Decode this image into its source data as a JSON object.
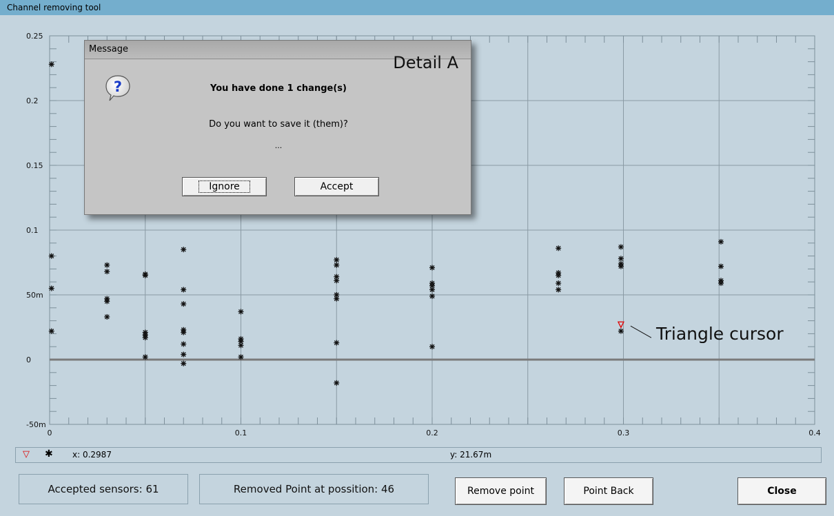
{
  "window": {
    "title": "Channel removing tool"
  },
  "chart_data": {
    "type": "scatter",
    "xlim": [
      0,
      0.4
    ],
    "ylim": [
      -0.05,
      0.25
    ],
    "x_ticks": [
      {
        "v": 0,
        "label": "0"
      },
      {
        "v": 0.1,
        "label": "0.1"
      },
      {
        "v": 0.2,
        "label": "0.2"
      },
      {
        "v": 0.3,
        "label": "0.3"
      },
      {
        "v": 0.4,
        "label": "0.4"
      }
    ],
    "y_ticks": [
      {
        "v": -0.05,
        "label": "-50m"
      },
      {
        "v": 0,
        "label": "0"
      },
      {
        "v": 0.05,
        "label": "50m"
      },
      {
        "v": 0.1,
        "label": "0.1"
      },
      {
        "v": 0.15,
        "label": "0.15"
      },
      {
        "v": 0.2,
        "label": "0.2"
      },
      {
        "v": 0.25,
        "label": "0.25"
      }
    ],
    "grid": true,
    "zero_line": true,
    "series": [
      {
        "marker": "asterisk",
        "points": [
          [
            0.001,
            0.228
          ],
          [
            0.001,
            0.08
          ],
          [
            0.001,
            0.055
          ],
          [
            0.001,
            0.022
          ],
          [
            0.03,
            0.073
          ],
          [
            0.03,
            0.068
          ],
          [
            0.03,
            0.047
          ],
          [
            0.03,
            0.045
          ],
          [
            0.03,
            0.033
          ],
          [
            0.05,
            0.066
          ],
          [
            0.05,
            0.065
          ],
          [
            0.05,
            0.021
          ],
          [
            0.05,
            0.019
          ],
          [
            0.05,
            0.017
          ],
          [
            0.05,
            0.002
          ],
          [
            0.07,
            0.085
          ],
          [
            0.07,
            0.054
          ],
          [
            0.07,
            0.043
          ],
          [
            0.07,
            0.023
          ],
          [
            0.07,
            0.021
          ],
          [
            0.07,
            0.012
          ],
          [
            0.07,
            0.004
          ],
          [
            0.07,
            -0.003
          ],
          [
            0.1,
            0.037
          ],
          [
            0.1,
            0.016
          ],
          [
            0.1,
            0.014
          ],
          [
            0.1,
            0.011
          ],
          [
            0.1,
            0.002
          ],
          [
            0.15,
            0.077
          ],
          [
            0.15,
            0.073
          ],
          [
            0.15,
            0.064
          ],
          [
            0.15,
            0.061
          ],
          [
            0.15,
            0.05
          ],
          [
            0.15,
            0.047
          ],
          [
            0.15,
            0.013
          ],
          [
            0.15,
            -0.018
          ],
          [
            0.2,
            0.071
          ],
          [
            0.2,
            0.059
          ],
          [
            0.2,
            0.057
          ],
          [
            0.2,
            0.054
          ],
          [
            0.2,
            0.049
          ],
          [
            0.2,
            0.01
          ],
          [
            0.266,
            0.086
          ],
          [
            0.266,
            0.067
          ],
          [
            0.266,
            0.065
          ],
          [
            0.266,
            0.059
          ],
          [
            0.266,
            0.054
          ],
          [
            0.2987,
            0.087
          ],
          [
            0.2987,
            0.078
          ],
          [
            0.2987,
            0.074
          ],
          [
            0.2987,
            0.072
          ],
          [
            0.2987,
            0.022
          ],
          [
            0.351,
            0.091
          ],
          [
            0.351,
            0.072
          ],
          [
            0.351,
            0.061
          ],
          [
            0.351,
            0.059
          ]
        ]
      },
      {
        "marker": "triangle-cursor",
        "color": "#e00000",
        "points": [
          [
            0.2987,
            0.027
          ]
        ]
      }
    ]
  },
  "annotation": {
    "triangle_label": "Triangle cursor"
  },
  "status": {
    "x_text": "x: 0.2987",
    "y_text": "y: 21.67m"
  },
  "footer": {
    "accepted": "Accepted sensors: 61",
    "removed": "Removed Point at possition: 46",
    "remove_button": "Remove point",
    "back_button": "Point Back",
    "close_button": "Close"
  },
  "dialog": {
    "title": "Message",
    "detail_label": "Detail A",
    "line1": "You have done 1 change(s)",
    "line2": "Do you want to save it (them)?",
    "line3": "...",
    "ignore_label": "Ignore",
    "accept_label": "Accept"
  }
}
